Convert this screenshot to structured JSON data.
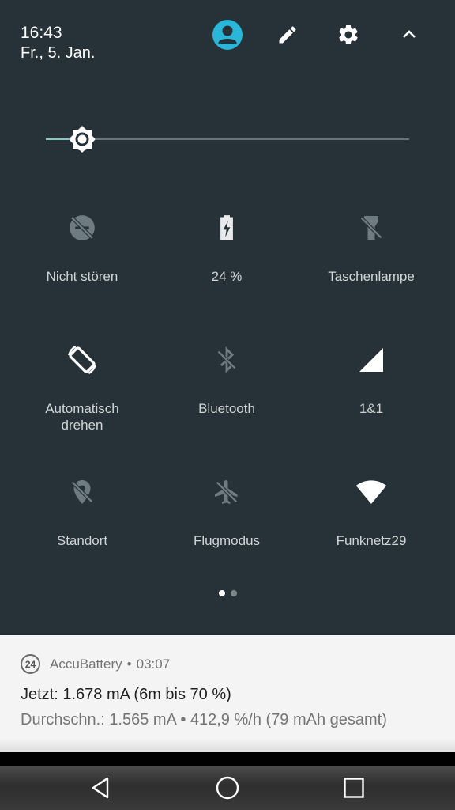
{
  "status": {
    "time": "16:43",
    "date": "Fr., 5. Jan."
  },
  "header": {
    "icons": [
      "account-icon",
      "edit-icon",
      "settings-icon",
      "collapse-icon"
    ],
    "accent_color": "#29b6d8"
  },
  "brightness": {
    "level_fraction": 0.1
  },
  "tiles": [
    {
      "label": "Nicht stören",
      "icon": "do-not-disturb-off-icon",
      "active": false
    },
    {
      "label": "24 %",
      "icon": "battery-charging-icon",
      "active": true
    },
    {
      "label": "Taschenlampe",
      "icon": "flashlight-off-icon",
      "active": false
    },
    {
      "label": "Automatisch\ndrehen",
      "icon": "auto-rotate-icon",
      "active": true
    },
    {
      "label": "Bluetooth",
      "icon": "bluetooth-off-icon",
      "active": false
    },
    {
      "label": "1&1",
      "icon": "cellular-signal-icon",
      "active": true
    },
    {
      "label": "Standort",
      "icon": "location-off-icon",
      "active": false
    },
    {
      "label": "Flugmodus",
      "icon": "airplane-off-icon",
      "active": false
    },
    {
      "label": "Funknetz29",
      "icon": "wifi-icon",
      "active": true
    }
  ],
  "pager": {
    "page_count": 2,
    "current_page": 1
  },
  "notification": {
    "badge": "24",
    "app_name": "AccuBattery",
    "separator": "•",
    "time": "03:07",
    "line1": "Jetzt: 1.678 mA (6m bis 70 %)",
    "line2": "Durchschn.: 1.565 mA • 412,9 %/h (79 mAh gesamt)"
  },
  "navbar": {
    "buttons": [
      "back-icon",
      "home-icon",
      "recents-icon"
    ]
  }
}
